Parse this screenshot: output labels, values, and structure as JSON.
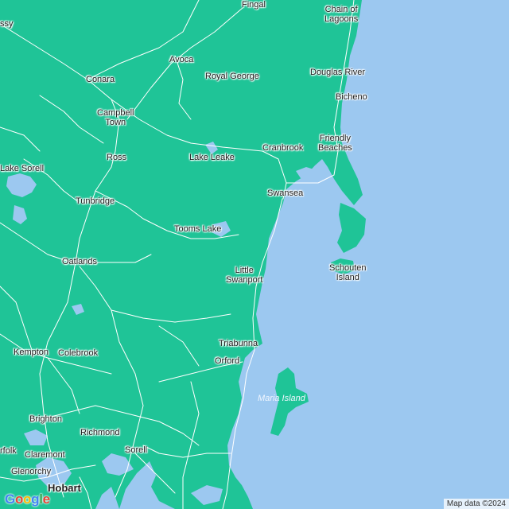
{
  "colors": {
    "sea": "#9cc8f0",
    "land": "#1fc497",
    "road": "#ffffff",
    "lake": "#9cc8f0"
  },
  "places": [
    {
      "id": "fingal",
      "name": "Fingal"
    },
    {
      "id": "chain-of-lagoons",
      "name": "Chain of\nLagoons"
    },
    {
      "id": "ssy",
      "name": "ssy"
    },
    {
      "id": "avoca",
      "name": "Avoca"
    },
    {
      "id": "conara",
      "name": "Conara"
    },
    {
      "id": "royal-george",
      "name": "Royal George"
    },
    {
      "id": "douglas-river",
      "name": "Douglas River"
    },
    {
      "id": "bicheno",
      "name": "Bicheno"
    },
    {
      "id": "campbell-town",
      "name": "Campbell\nTown"
    },
    {
      "id": "friendly-beaches",
      "name": "Friendly\nBeaches"
    },
    {
      "id": "cranbrook",
      "name": "Cranbrook"
    },
    {
      "id": "lake-leake",
      "name": "Lake Leake"
    },
    {
      "id": "ross",
      "name": "Ross"
    },
    {
      "id": "lake-sorell",
      "name": "Lake Sorell"
    },
    {
      "id": "swansea",
      "name": "Swansea"
    },
    {
      "id": "tunbridge",
      "name": "Tunbridge"
    },
    {
      "id": "tooms-lake",
      "name": "Tooms Lake"
    },
    {
      "id": "schouten-island",
      "name": "Schouten\nIsland"
    },
    {
      "id": "oatlands",
      "name": "Oatlands"
    },
    {
      "id": "little-swanport",
      "name": "Little\nSwanport"
    },
    {
      "id": "kempton",
      "name": "Kempton"
    },
    {
      "id": "colebrook",
      "name": "Colebrook"
    },
    {
      "id": "triabunna",
      "name": "Triabunna"
    },
    {
      "id": "orford",
      "name": "Orford"
    },
    {
      "id": "maria-island",
      "name": "Maria Island"
    },
    {
      "id": "brighton",
      "name": "Brighton"
    },
    {
      "id": "richmond",
      "name": "Richmond"
    },
    {
      "id": "sorell",
      "name": "Sorell"
    },
    {
      "id": "claremont",
      "name": "Claremont"
    },
    {
      "id": "rfolk",
      "name": "rfolk"
    },
    {
      "id": "glenorchy",
      "name": "Glenorchy"
    },
    {
      "id": "hobart",
      "name": "Hobart"
    }
  ],
  "logo": {
    "letters": [
      "G",
      "o",
      "o",
      "g",
      "l",
      "e"
    ],
    "colors": [
      "#4285F4",
      "#EA4335",
      "#FBBC05",
      "#4285F4",
      "#34A853",
      "#EA4335"
    ]
  },
  "attribution": "Map data ©2024"
}
